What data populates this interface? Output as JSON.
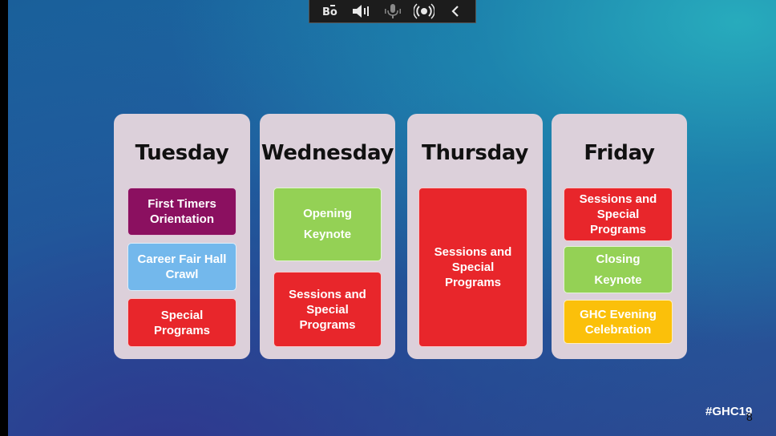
{
  "toolbar": {
    "buttons": [
      {
        "name": "subtitles-icon"
      },
      {
        "name": "speaker-icon"
      },
      {
        "name": "microphone-icon"
      },
      {
        "name": "broadcast-icon"
      },
      {
        "name": "chevron-left-icon"
      }
    ]
  },
  "days": [
    {
      "title": "Tuesday",
      "items": [
        {
          "label": "First Timers\nOrientation",
          "color": "#8b1060"
        },
        {
          "label": "Career Fair  Hall\nCrawl",
          "color": "#73b8ec"
        },
        {
          "label": "Special\nPrograms",
          "color": "#e8262b"
        }
      ]
    },
    {
      "title": "Wednesday",
      "items": [
        {
          "label": "Opening\nKeynote",
          "color": "#94d155"
        },
        {
          "label": "Sessions and\nSpecial\nPrograms",
          "color": "#e8262b"
        }
      ]
    },
    {
      "title": "Thursday",
      "items": [
        {
          "label": "Sessions and\nSpecial\nPrograms",
          "color": "#e8262b"
        }
      ]
    },
    {
      "title": "Friday",
      "items": [
        {
          "label": "Sessions and\nSpecial\nPrograms",
          "color": "#e8262b"
        },
        {
          "label": "Closing\nKeynote",
          "color": "#94d155"
        },
        {
          "label": "GHC Evening\nCelebration",
          "color": "#fbc00a"
        }
      ]
    }
  ],
  "footer": {
    "hashtag": "#GHC19",
    "page_number": "8"
  }
}
